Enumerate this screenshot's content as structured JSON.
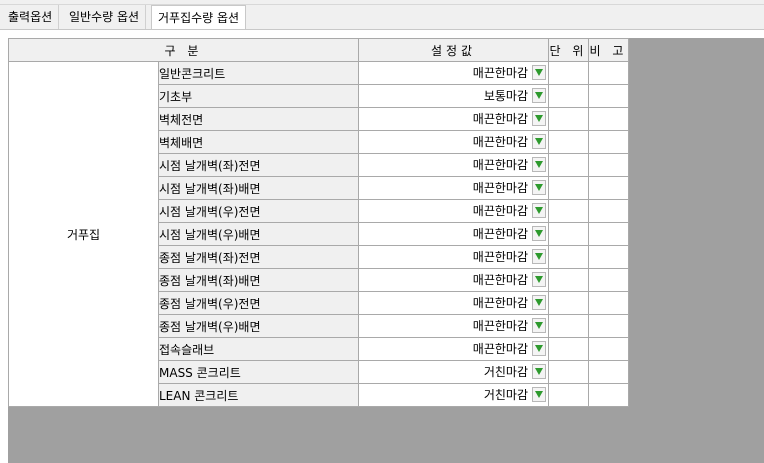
{
  "tabs": [
    {
      "label": "출력옵션",
      "active": false
    },
    {
      "label": "일반수량 옵션",
      "active": false
    },
    {
      "label": "거푸집수량 옵션",
      "active": true
    }
  ],
  "table": {
    "headers": {
      "category": "구 분",
      "value": "설정값",
      "unit": "단 위",
      "note": "비 고"
    },
    "category_label": "거푸집",
    "rows": [
      {
        "item": "일반콘크리트",
        "value": "매끈한마감"
      },
      {
        "item": "기초부",
        "value": "보통마감"
      },
      {
        "item": "벽체전면",
        "value": "매끈한마감"
      },
      {
        "item": "벽체배면",
        "value": "매끈한마감"
      },
      {
        "item": "시점 날개벽(좌)전면",
        "value": "매끈한마감"
      },
      {
        "item": "시점 날개벽(좌)배면",
        "value": "매끈한마감"
      },
      {
        "item": "시점 날개벽(우)전면",
        "value": "매끈한마감"
      },
      {
        "item": "시점 날개벽(우)배면",
        "value": "매끈한마감"
      },
      {
        "item": "종점 날개벽(좌)전면",
        "value": "매끈한마감"
      },
      {
        "item": "종점 날개벽(좌)배면",
        "value": "매끈한마감"
      },
      {
        "item": "종점 날개벽(우)전면",
        "value": "매끈한마감"
      },
      {
        "item": "종점 날개벽(우)배면",
        "value": "매끈한마감"
      },
      {
        "item": "접속슬래브",
        "value": "매끈한마감"
      },
      {
        "item": "MASS 콘크리트",
        "value": "거친마감"
      },
      {
        "item": "LEAN 콘크리트",
        "value": "거친마감"
      }
    ]
  },
  "colors": {
    "dropdown_arrow": "#2e9a2e",
    "grid_background": "#a0a0a0"
  },
  "icons": {
    "dropdown": "dropdown-arrow-icon"
  }
}
